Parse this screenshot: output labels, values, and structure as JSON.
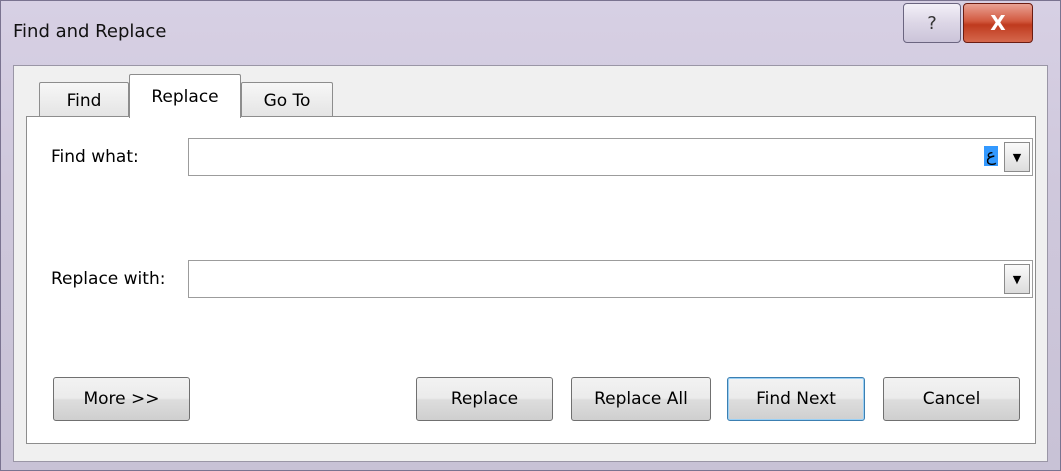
{
  "window": {
    "title": "Find and Replace",
    "help_glyph": "?",
    "close_glyph": "X"
  },
  "tabs": [
    {
      "label": "Find",
      "active": false
    },
    {
      "label": "Replace",
      "active": true
    },
    {
      "label": "Go To",
      "active": false
    }
  ],
  "find": {
    "label": "Find what:",
    "value": "",
    "ime_indicator": "ع",
    "dropdown_glyph": "▼"
  },
  "replace": {
    "label": "Replace with:",
    "value": "",
    "dropdown_glyph": "▼"
  },
  "buttons": {
    "more": "More >>",
    "replace": "Replace",
    "replace_all": "Replace All",
    "find_next": "Find Next",
    "cancel": "Cancel"
  }
}
